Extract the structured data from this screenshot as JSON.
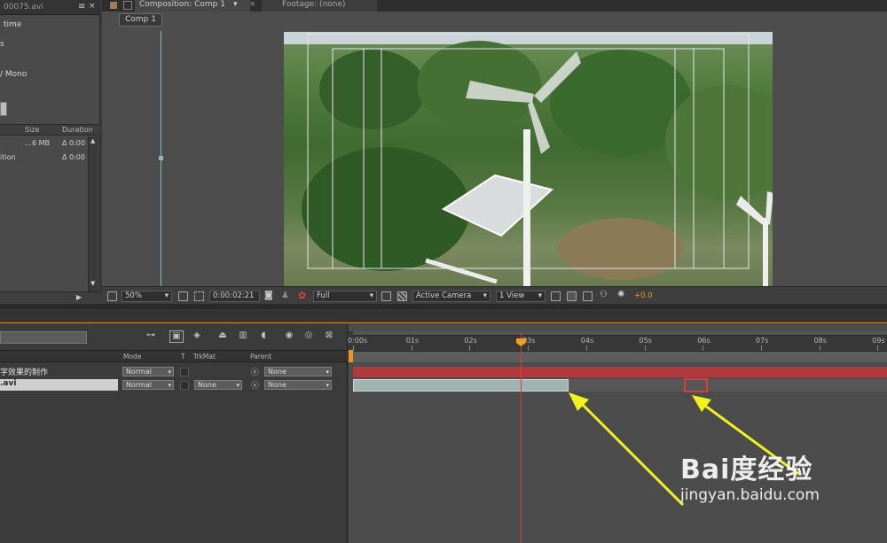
{
  "project": {
    "tab_title": "00075.avi",
    "info_lines": [
      "time",
      "s",
      "/ Mono"
    ],
    "columns": [
      "Size",
      "Duration"
    ],
    "rows": [
      {
        "name": "",
        "size": "…6 MB",
        "duration": "Δ 0:00"
      },
      {
        "name": "ition",
        "size": "",
        "duration": "Δ 0:00"
      }
    ]
  },
  "composition": {
    "tab_title": "Composition: Comp 1",
    "footage_tab": "Footage: (none)",
    "comp_button": "Comp 1",
    "toolbar": {
      "zoom": "50%",
      "timecode": "0:00:02:21",
      "resolution": "Full",
      "camera": "Active Camera",
      "views": "1 View",
      "exposure": "+0.0"
    }
  },
  "timeline": {
    "columns": {
      "mode": "Mode",
      "t": "T",
      "trkmat": "TrkMat",
      "parent": "Parent"
    },
    "layers": [
      {
        "name": "字效果的制作",
        "mode": "Normal",
        "trkmat": "",
        "parent": "None"
      },
      {
        "name": ".avi",
        "mode": "Normal",
        "trkmat": "None",
        "parent": "None"
      }
    ],
    "ruler": [
      "0:00s",
      "01s",
      "02s",
      "03s",
      "04s",
      "05s",
      "06s",
      "07s",
      "08s",
      "09s"
    ],
    "current_time_sec": 2.875,
    "layer2_out_sec": 3.7
  },
  "watermark": {
    "logo": "Bai度经验",
    "url": "jingyan.baidu.com"
  },
  "colors": {
    "accent": "#e89a20",
    "layer_red": "#b0393b",
    "layer_teal": "#9fb4b1",
    "annotation_arrow": "#f2f21a",
    "highlight_box": "#e03a3a"
  }
}
